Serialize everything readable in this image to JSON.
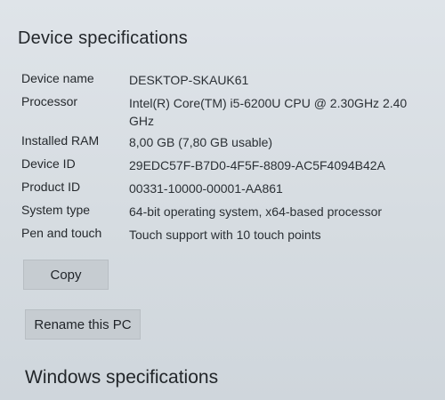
{
  "device_specifications": {
    "title": "Device specifications",
    "rows": [
      {
        "label": "Device name",
        "value": "DESKTOP-SKAUK61"
      },
      {
        "label": "Processor",
        "value": "Intel(R) Core(TM) i5-6200U CPU @ 2.30GHz   2.40 GHz"
      },
      {
        "label": "Installed RAM",
        "value": "8,00 GB (7,80 GB usable)"
      },
      {
        "label": "Device ID",
        "value": "29EDC57F-B7D0-4F5F-8809-AC5F4094B42A"
      },
      {
        "label": "Product ID",
        "value": "00331-10000-00001-AA861"
      },
      {
        "label": "System type",
        "value": "64-bit operating system, x64-based processor"
      },
      {
        "label": "Pen and touch",
        "value": "Touch support with 10 touch points"
      }
    ],
    "copy_label": "Copy",
    "rename_label": "Rename this PC"
  },
  "windows_specifications": {
    "title": "Windows specifications"
  }
}
